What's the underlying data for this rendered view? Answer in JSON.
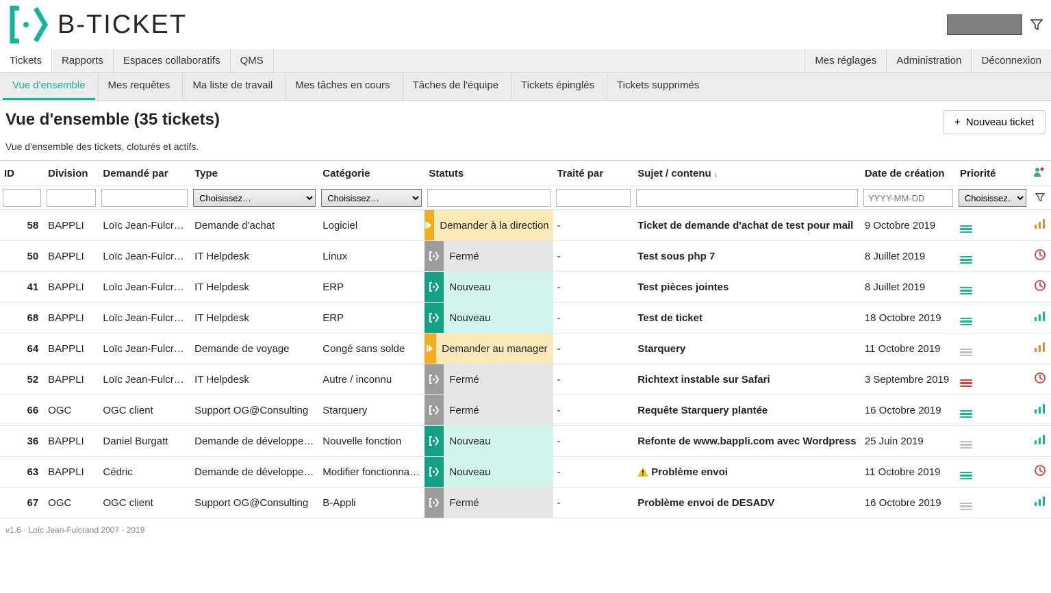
{
  "app": {
    "name": "B-TICKET"
  },
  "topnav_left": [
    "Tickets",
    "Rapports",
    "Espaces collaboratifs",
    "QMS"
  ],
  "topnav_right": [
    "Mes réglages",
    "Administration",
    "Déconnexion"
  ],
  "topnav_active": 0,
  "subnav": [
    "Vue d'ensemble",
    "Mes requêtes",
    "Ma liste de travail",
    "Mes tâches en cours",
    "Tâches de l'équipe",
    "Tickets épinglés",
    "Tickets supprimés"
  ],
  "subnav_active": 0,
  "page": {
    "title": "Vue d'ensemble (35 tickets)",
    "subtitle": "Vue d'ensemble des tickets, cloturés et actifs.",
    "new_ticket_label": "Nouveau ticket"
  },
  "columns": {
    "id": "ID",
    "division": "Division",
    "requested_by": "Demandé par",
    "type": "Type",
    "category": "Catégorie",
    "status": "Statuts",
    "handled_by": "Traité par",
    "subject": "Sujet / contenu",
    "created": "Date de création",
    "priority": "Priorité"
  },
  "sort_indicator": "↓",
  "filters": {
    "select_placeholder": "Choisissez…",
    "date_placeholder": "YYYY-MM-DD"
  },
  "status_styles": {
    "Fermé": "st-gray",
    "Nouveau": "st-teal",
    "Demander à la direction": "st-amber",
    "Demander au manager": "st-amber"
  },
  "tickets": [
    {
      "id": 58,
      "division": "BAPPLI",
      "req": "Loïc Jean-Fulcrand",
      "type": "Demande d'achat",
      "cat": "Logiciel",
      "status": "Demander à la direction",
      "handled": "-",
      "subject": "Ticket de demande d'achat de test pour mail",
      "created": "9 Octobre 2019",
      "prio": "lines-teal",
      "extra": "bars-orange",
      "warn": false
    },
    {
      "id": 50,
      "division": "BAPPLI",
      "req": "Loïc Jean-Fulcrand",
      "type": "IT Helpdesk",
      "cat": "Linux",
      "status": "Fermé",
      "handled": "-",
      "subject": "Test sous php 7",
      "created": "8 Juillet 2019",
      "prio": "lines-teal",
      "extra": "clock-red",
      "warn": false
    },
    {
      "id": 41,
      "division": "BAPPLI",
      "req": "Loïc Jean-Fulcrand",
      "type": "IT Helpdesk",
      "cat": "ERP",
      "status": "Nouveau",
      "handled": "-",
      "subject": "Test pièces jointes",
      "created": "8 Juillet 2019",
      "prio": "lines-teal",
      "extra": "clock-red",
      "warn": false
    },
    {
      "id": 68,
      "division": "BAPPLI",
      "req": "Loïc Jean-Fulcrand",
      "type": "IT Helpdesk",
      "cat": "ERP",
      "status": "Nouveau",
      "handled": "-",
      "subject": "Test de ticket",
      "created": "18 Octobre 2019",
      "prio": "lines-teal",
      "extra": "bars-green",
      "warn": false
    },
    {
      "id": 64,
      "division": "BAPPLI",
      "req": "Loïc Jean-Fulcrand",
      "type": "Demande de voyage",
      "cat": "Congé sans solde",
      "status": "Demander au manager",
      "handled": "-",
      "subject": "Starquery",
      "created": "11 Octobre 2019",
      "prio": "lines-gray",
      "extra": "bars-orange",
      "warn": false
    },
    {
      "id": 52,
      "division": "BAPPLI",
      "req": "Loïc Jean-Fulcrand",
      "type": "IT Helpdesk",
      "cat": "Autre / inconnu",
      "status": "Fermé",
      "handled": "-",
      "subject": "Richtext instable sur Safari",
      "created": "3 Septembre 2019",
      "prio": "lines-red",
      "extra": "clock-red",
      "warn": false
    },
    {
      "id": 66,
      "division": "OGC",
      "req": "OGC client",
      "type": "Support OG@Consulting",
      "cat": "Starquery",
      "status": "Fermé",
      "handled": "-",
      "subject": "Requête Starquery plantée",
      "created": "16 Octobre 2019",
      "prio": "lines-teal",
      "extra": "bars-green",
      "warn": false
    },
    {
      "id": 36,
      "division": "BAPPLI",
      "req": "Daniel Burgatt",
      "type": "Demande de développement",
      "cat": "Nouvelle fonction",
      "status": "Nouveau",
      "handled": "-",
      "subject": "Refonte de www.bappli.com avec Wordpress",
      "created": "25 Juin 2019",
      "prio": "lines-gray",
      "extra": "bars-green",
      "warn": false
    },
    {
      "id": 63,
      "division": "BAPPLI",
      "req": "Cédric",
      "type": "Demande de développement",
      "cat": "Modifier fonctionnalité",
      "status": "Nouveau",
      "handled": "-",
      "subject": "Problème envoi",
      "created": "11 Octobre 2019",
      "prio": "lines-teal",
      "extra": "clock-red",
      "warn": true
    },
    {
      "id": 67,
      "division": "OGC",
      "req": "OGC client",
      "type": "Support OG@Consulting",
      "cat": "B-Appli",
      "status": "Fermé",
      "handled": "-",
      "subject": "Problème envoi de DESADV",
      "created": "16 Octobre 2019",
      "prio": "lines-gray",
      "extra": "bars-green",
      "warn": false
    }
  ],
  "footer": "v1.6 - Loïc Jean-Fulcrand 2007 - 2019"
}
